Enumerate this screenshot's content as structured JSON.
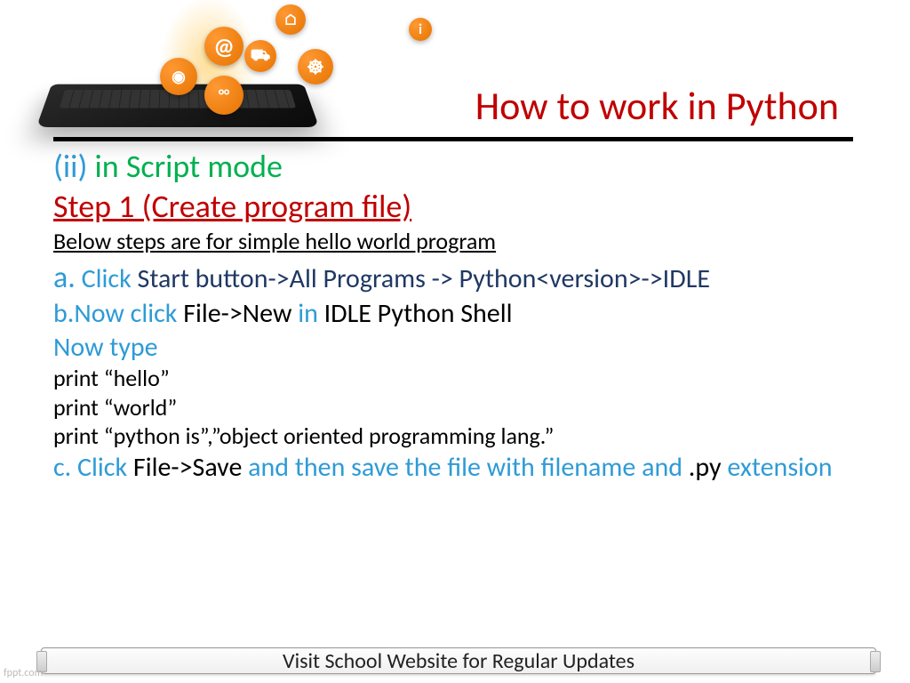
{
  "title": "How to work in Python",
  "subtitle": {
    "num": "(ii)",
    "mode": " in Script mode"
  },
  "step_heading": "Step 1 (Create program file)",
  "subnote": "Below steps are for simple hello world program",
  "step_a": {
    "prefix": "a.",
    "action": " Click",
    "path": " Start button->All Programs   ->   Python<version>->IDLE"
  },
  "step_b": {
    "prefix": "b.",
    "action": "Now click",
    "path1": " File->New ",
    "in": "in",
    "path2": " IDLE Python Shell"
  },
  "now_type": "Now type",
  "code": {
    "l1": "print “hello”",
    "l2": "print “world”",
    "l3": "print “python is”,”object oriented programming lang.”"
  },
  "step_c": {
    "prefix": "c. Click",
    "path": " File->Save ",
    "rest1": "and then save the file with filename and ",
    "ext": ".py",
    "rest2": " extension"
  },
  "footer": "Visit School Website for Regular Updates",
  "watermark": "fppt.com",
  "icons": {
    "at": "@",
    "home": "⌂",
    "info": "i",
    "cart": "⛟",
    "globe": "☸",
    "net": "◉",
    "people": "°°"
  }
}
